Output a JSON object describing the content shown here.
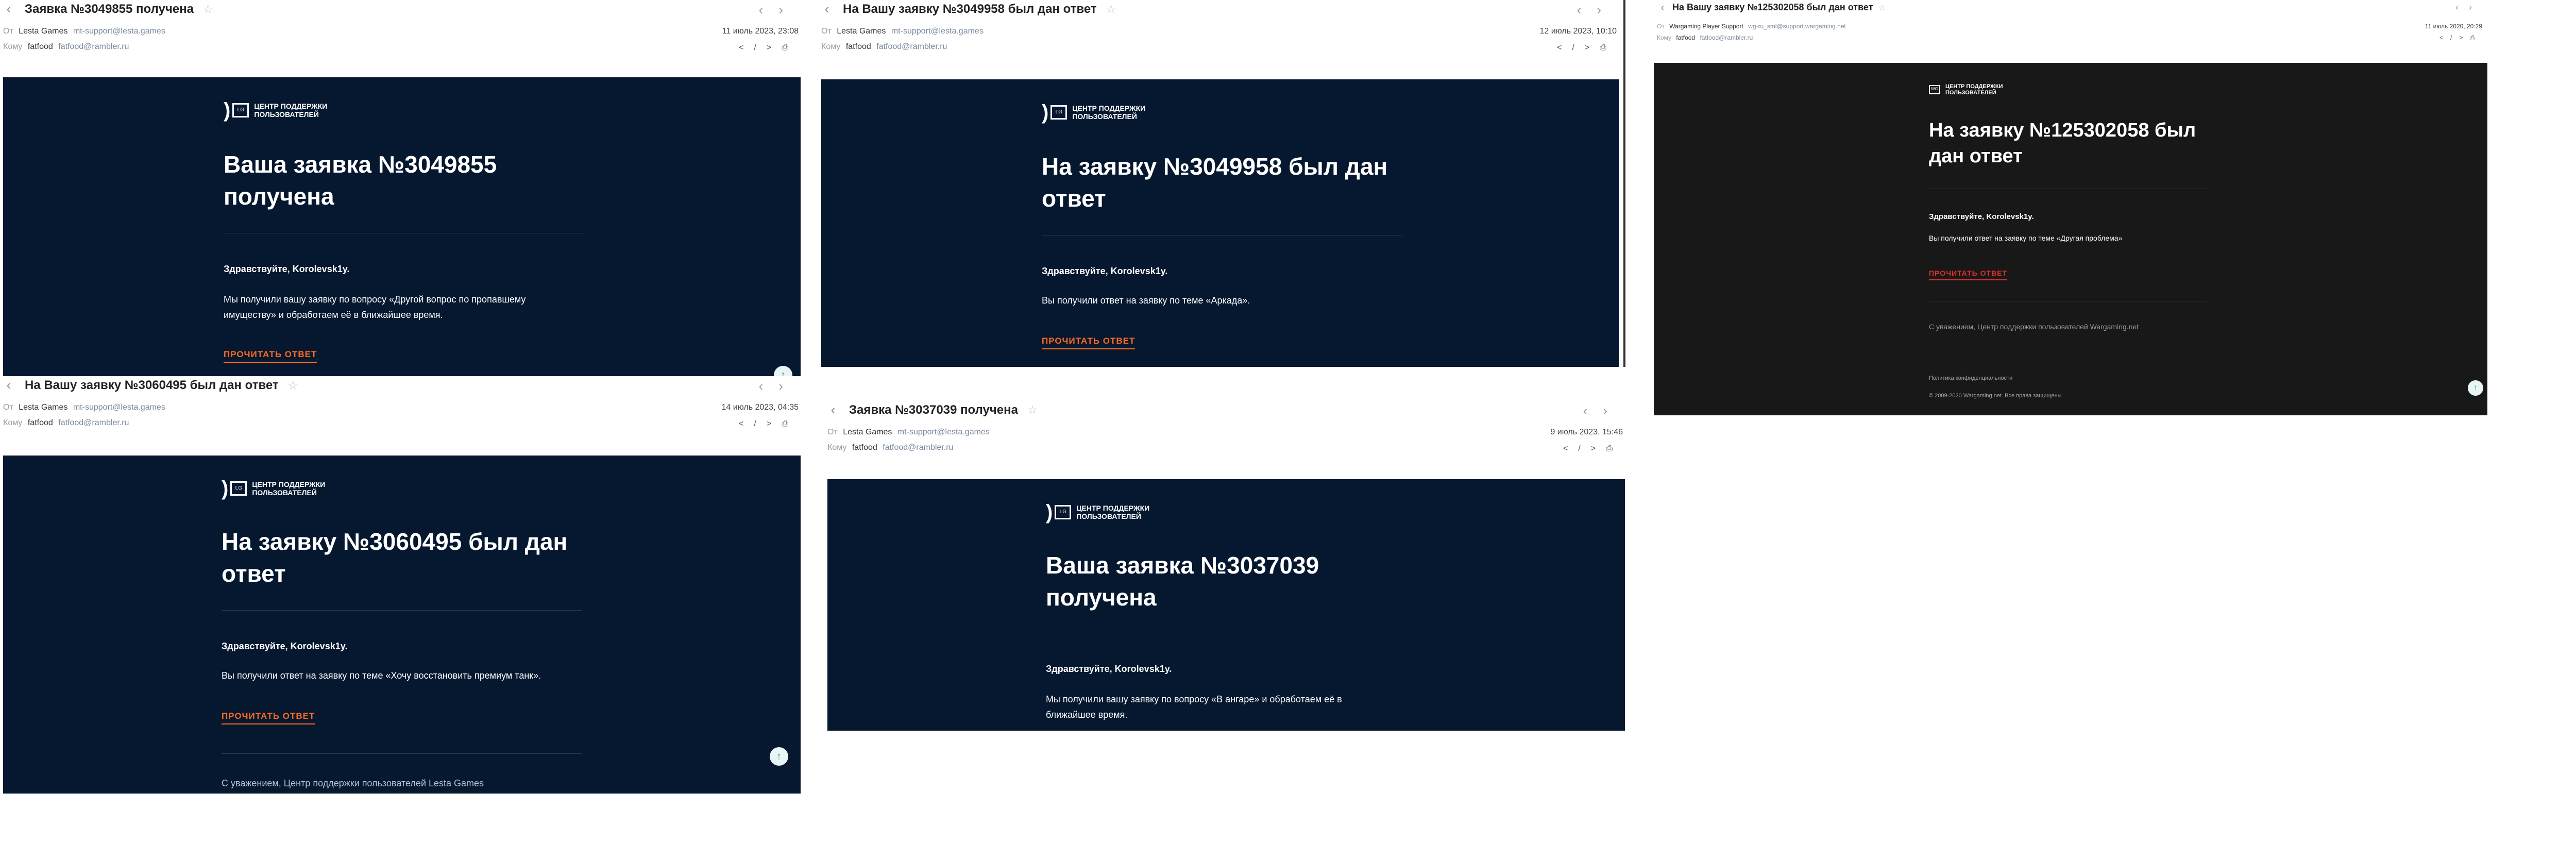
{
  "common": {
    "from_label": "От",
    "to_label": "Кому",
    "to_name": "fatfood",
    "to_email": "fatfood@rambler.ru",
    "lesta_logo_text": "ЦЕНТР ПОДДЕРЖКИ\nПОЛЬЗОВАТЕЛЕЙ",
    "greeting": "Здравствуйте, Korolevsk1y.",
    "read_button": "ПРОЧИТАТЬ ОТВЕТ",
    "signature_lesta": "С уважением, Центр поддержки пользователей Lesta Games"
  },
  "emails": [
    {
      "subject": "Заявка №3049855 получена",
      "from_name": "Lesta Games",
      "from_email": "mt-support@lesta.games",
      "date": "11 июль 2023, 23:08",
      "heading": "Ваша заявка №3049855 получена",
      "body": "Мы получили вашу заявку по вопросу «Другой вопрос по пропавшему имуществу» и обработаем её в ближайшее время."
    },
    {
      "subject": "На Вашу заявку №3049958 был дан ответ",
      "from_name": "Lesta Games",
      "from_email": "mt-support@lesta.games",
      "date": "12 июль 2023, 10:10",
      "heading": "На заявку №3049958 был дан ответ",
      "body": "Вы получили ответ на заявку по теме «Аркада»."
    },
    {
      "subject": "На Вашу заявку №125302058 был дан ответ",
      "from_name": "Wargaming Player Support",
      "from_email": "wg-ru_sml@support.wargaming.net",
      "date": "11 июль 2020, 20:29",
      "heading": "На заявку №125302058 был дан ответ",
      "greeting": "Здравствуйте, Korolevsk1y.",
      "body": "Вы получили ответ на заявку по теме «Другая проблема»",
      "signature": "С уважением, Центр поддержки пользователей Wargaming.net",
      "privacy": "Политика конфиденциальности",
      "copyright": "© 2009-2020 Wargaming.net. Все права защищены"
    },
    {
      "subject": "На Вашу заявку №3060495 был дан ответ",
      "from_name": "Lesta Games",
      "from_email": "mt-support@lesta.games",
      "date": "14 июль 2023, 04:35",
      "heading": "На заявку №3060495 был дан ответ",
      "body": "Вы получили ответ на заявку по теме «Хочу восстановить премиум танк»."
    },
    {
      "subject": "Заявка №3037039 получена",
      "from_name": "Lesta Games",
      "from_email": "mt-support@lesta.games",
      "date": "9 июль 2023, 15:46",
      "heading": "Ваша заявка №3037039 получена",
      "body": "Мы получили вашу заявку по вопросу «В ангаре» и обработаем её в ближайшее время."
    }
  ],
  "icons": {
    "back": "chevron-left-icon",
    "star": "star-icon",
    "prev": "chevron-left-icon",
    "next": "chevron-right-icon",
    "code": "code-icon",
    "print": "print-icon",
    "scroll_top": "arrow-up-icon"
  }
}
